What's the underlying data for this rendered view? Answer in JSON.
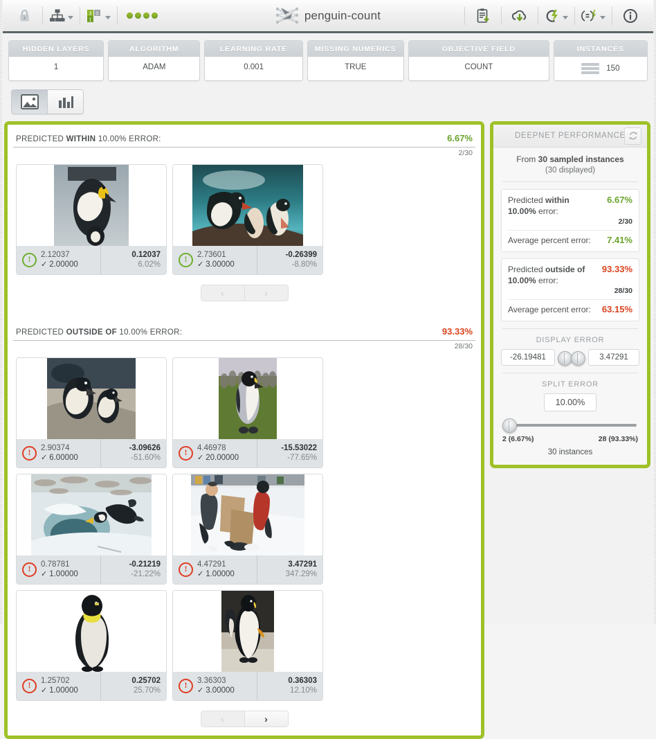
{
  "toolbar": {
    "left_icons": [
      {
        "name": "lock-icon",
        "label": "Lock"
      },
      {
        "name": "network-icon",
        "label": "Resource type"
      },
      {
        "name": "dataset-icon",
        "label": "Dataset"
      }
    ],
    "status_dots": 4,
    "title": "penguin-count",
    "right_icons": [
      {
        "name": "clipboard-download-icon",
        "label": "Download"
      },
      {
        "name": "cloud-download-icon",
        "label": "Export"
      },
      {
        "name": "flash-split-icon",
        "label": "Batch prediction"
      },
      {
        "name": "equals-flash-icon",
        "label": "Evaluate"
      },
      {
        "name": "info-icon",
        "label": "Info"
      }
    ]
  },
  "config": [
    {
      "label": "HIDDEN LAYERS",
      "value": "1"
    },
    {
      "label": "ALGORITHM",
      "value": "ADAM"
    },
    {
      "label": "LEARNING RATE",
      "value": "0.001"
    },
    {
      "label": "MISSING NUMERICS",
      "value": "TRUE"
    },
    {
      "label": "OBJECTIVE FIELD",
      "value": "COUNT"
    },
    {
      "label": "INSTANCES",
      "value": "150",
      "icon": "list-icon"
    }
  ],
  "view_tabs": [
    {
      "name": "tab-images",
      "icon": "image-icon",
      "active": true
    },
    {
      "name": "tab-chart",
      "icon": "bar-chart-icon",
      "active": false
    }
  ],
  "sections": [
    {
      "id": "within",
      "title_pre": "PREDICTED ",
      "title_strong": "WITHIN",
      "title_post": " 10.00% ERROR:",
      "percent": "6.67%",
      "percent_tone": "good",
      "count": "2/30",
      "cards": [
        {
          "predicted": "2.12037",
          "actual": "2.00000",
          "diff": "0.12037",
          "diff_pct": "6.02%",
          "status": "ok",
          "image_alt": "march-of-the-penguins-poster"
        },
        {
          "predicted": "2.73601",
          "actual": "3.00000",
          "diff": "-0.26399",
          "diff_pct": "-8.80%",
          "status": "ok",
          "image_alt": "gentoo-penguin-with-chicks"
        }
      ],
      "pager": {
        "prev": "‹",
        "next": "›",
        "prev_enabled": false,
        "next_enabled": false
      }
    },
    {
      "id": "outside",
      "title_pre": "PREDICTED ",
      "title_strong": "OUTSIDE OF",
      "title_post": " 10.00% ERROR:",
      "percent": "93.33%",
      "percent_tone": "bad",
      "count": "28/30",
      "cards": [
        {
          "predicted": "2.90374",
          "actual": "6.00000",
          "diff": "-3.09626",
          "diff_pct": "-51.60%",
          "status": "err",
          "image_alt": "african-penguins-on-rocks"
        },
        {
          "predicted": "4.46978",
          "actual": "20.00000",
          "diff": "-15.53022",
          "diff_pct": "-77.65%",
          "status": "err",
          "image_alt": "king-penguin-colony-grass"
        },
        {
          "predicted": "0.78781",
          "actual": "1.00000",
          "diff": "-0.21219",
          "diff_pct": "-21.22%",
          "status": "err",
          "image_alt": "penguin-jumping-into-water"
        },
        {
          "predicted": "4.47291",
          "actual": "1.00000",
          "diff": "3.47291",
          "diff_pct": "347.29%",
          "status": "err",
          "image_alt": "researchers-with-boards-in-snow"
        },
        {
          "predicted": "1.25702",
          "actual": "1.00000",
          "diff": "0.25702",
          "diff_pct": "25.70%",
          "status": "err",
          "image_alt": "emperor-penguin-white-background"
        },
        {
          "predicted": "3.36303",
          "actual": "3.00000",
          "diff": "0.36303",
          "diff_pct": "12.10%",
          "status": "err",
          "image_alt": "emperor-penguins-standing"
        }
      ],
      "pager": {
        "prev": "‹",
        "next": "›",
        "prev_enabled": false,
        "next_enabled": true
      }
    }
  ],
  "sidebar": {
    "header": "DEEPNET PERFORMANCE",
    "refresh_icon": "refresh-icon",
    "sampled_pre": "From ",
    "sampled_strong": "30 sampled instances",
    "displayed": "(30 displayed)",
    "stats": [
      {
        "label_pre": "Predicted ",
        "label_strong": "within",
        "label_post": "",
        "label_line2_strong": "10.00%",
        "label_line2_post": " error:",
        "value": "6.67%",
        "tone": "good",
        "sub": "2/30",
        "avg_label": "Average percent error:",
        "avg_value": "7.41%",
        "avg_tone": "good"
      },
      {
        "label_pre": "Predicted ",
        "label_strong": "outside of",
        "label_post": "",
        "label_line2_strong": "10.00%",
        "label_line2_post": " error:",
        "value": "93.33%",
        "tone": "bad",
        "sub": "28/30",
        "avg_label": "Average percent error:",
        "avg_value": "63.15%",
        "avg_tone": "bad"
      }
    ],
    "display_error": {
      "label": "DISPLAY ERROR",
      "min": "-26.19481",
      "max": "3.47291"
    },
    "split_error": {
      "label": "SPLIT ERROR",
      "value": "10.00%",
      "left_count": "2 (6.67%)",
      "right_count": "28 (93.33%)",
      "instances": "30 instances"
    }
  },
  "colors": {
    "accent_green": "#9ec127",
    "good": "#6aa42c",
    "bad": "#d8441f",
    "toolbar_rule": "#5b6468"
  }
}
